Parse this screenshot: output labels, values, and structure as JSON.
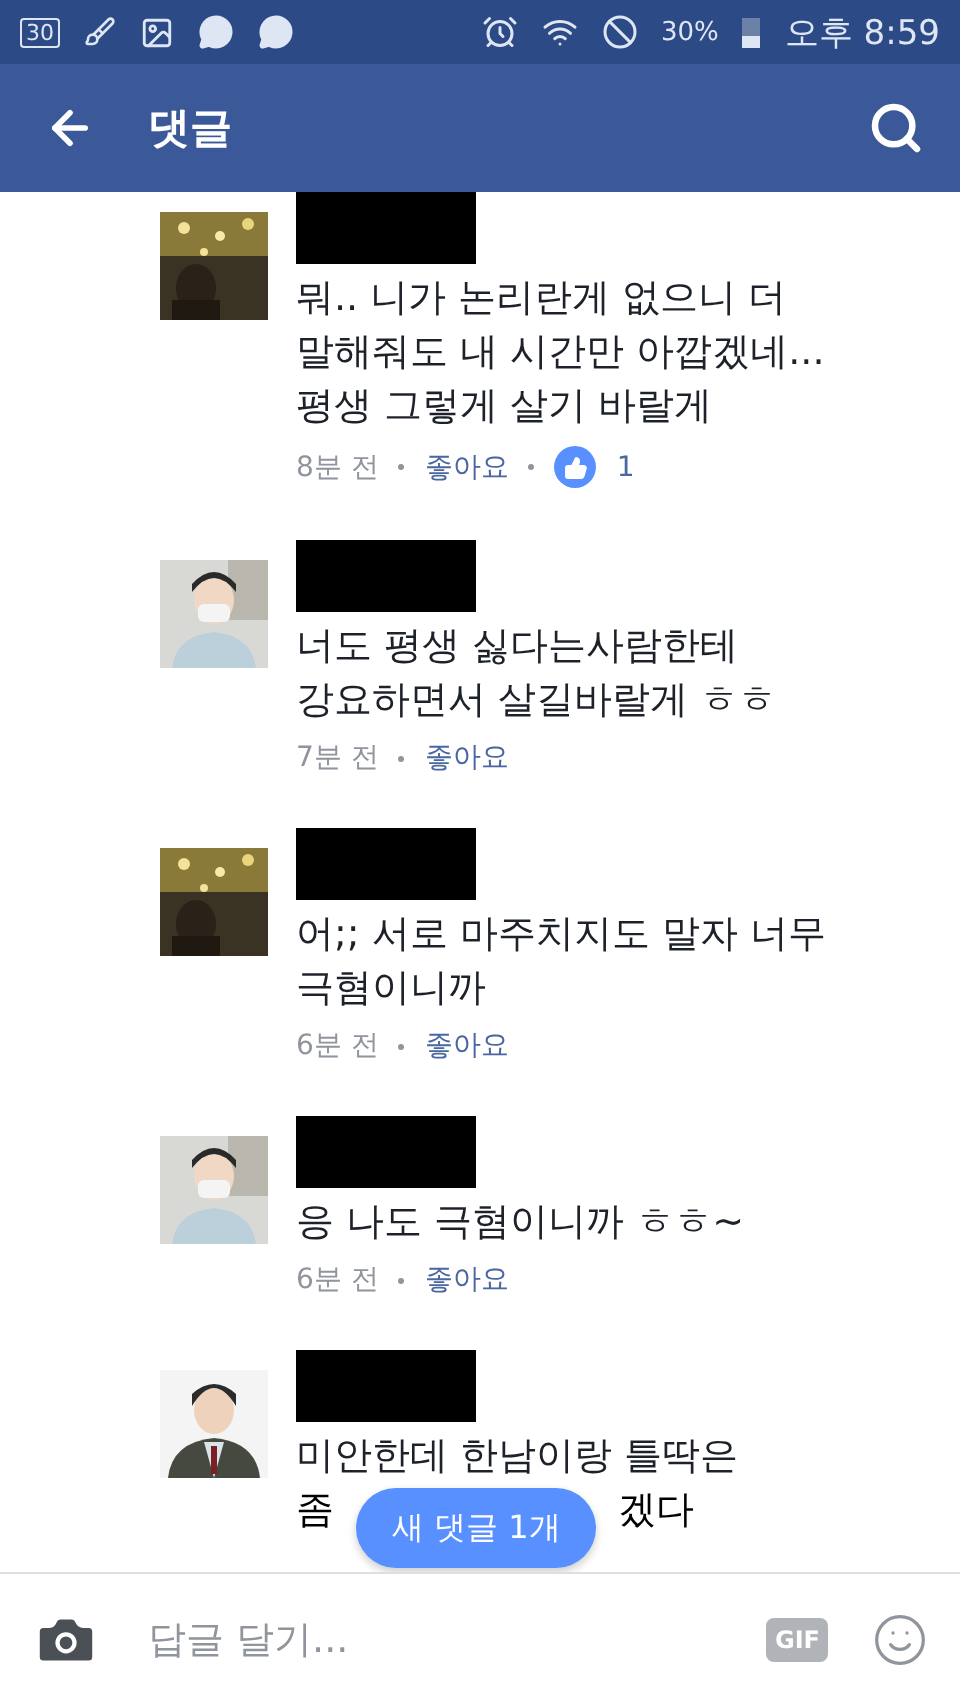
{
  "status_bar": {
    "notification_badge": "30",
    "battery_percent": "30%",
    "time": "오후 8:59"
  },
  "header": {
    "title": "댓글"
  },
  "comments": [
    {
      "lines": [
        "뭐.. 니가 논리란게 없으니 더",
        "말해줘도 내 시간만 아깝겠네...",
        "평생 그렇게 살기 바랄게"
      ],
      "time": "8분 전",
      "like_label": "좋아요",
      "reaction_count": "1"
    },
    {
      "lines": [
        "너도 평생 싫다는사람한테",
        "강요하면서 살길바랄게 ㅎㅎ"
      ],
      "time": "7분 전",
      "like_label": "좋아요"
    },
    {
      "lines": [
        "어;; 서로 마주치지도 말자 너무",
        "극혐이니까"
      ],
      "time": "6분 전",
      "like_label": "좋아요"
    },
    {
      "lines": [
        "응 나도 극혐이니까 ㅎㅎ~"
      ],
      "time": "6분 전",
      "like_label": "좋아요"
    },
    {
      "lines": [
        "미안한데 한남이랑 틀딱은"
      ],
      "partial_line": [
        "좀",
        "겠다"
      ]
    }
  ],
  "new_comments_pill": "새 댓글 1개",
  "reply_bar": {
    "placeholder": "답글 달기...",
    "gif_label": "GIF"
  }
}
